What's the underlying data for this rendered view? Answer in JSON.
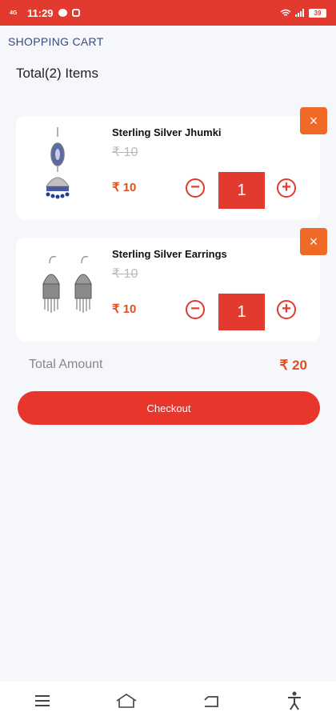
{
  "status_bar": {
    "network_label": "4G",
    "time": "11:29",
    "battery": "39"
  },
  "header": {
    "title": "SHOPPING CART"
  },
  "cart": {
    "count_label": "Total(2) Items",
    "items": [
      {
        "name": "Sterling Silver Jhumki",
        "old_price": "₹ 10",
        "price": "₹ 10",
        "quantity": "1",
        "image_icon": "jhumki-earring-image"
      },
      {
        "name": "Sterling Silver Earrings",
        "old_price": "₹ 10",
        "price": "₹ 10",
        "quantity": "1",
        "image_icon": "earrings-image"
      }
    ],
    "remove_label": "×",
    "minus_label": "−",
    "plus_label": "+"
  },
  "summary": {
    "total_label": "Total Amount",
    "total_value": "₹ 20"
  },
  "checkout": {
    "label": "Checkout"
  },
  "colors": {
    "primary": "#e23a2f",
    "accent": "#ef6a27",
    "price": "#e0501f"
  }
}
